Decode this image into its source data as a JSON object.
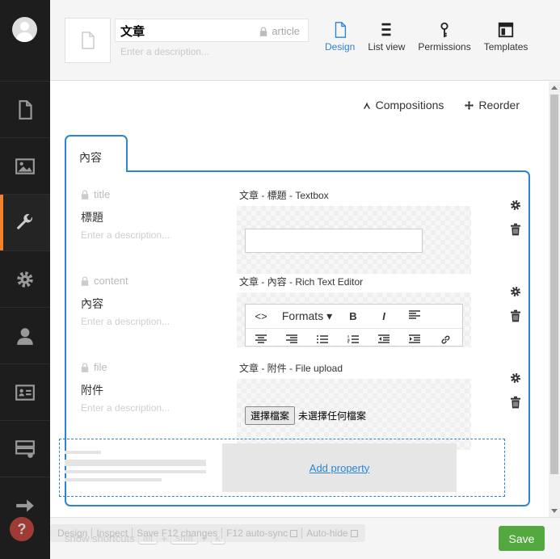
{
  "header": {
    "name_value": "文章",
    "alias": "article",
    "description_placeholder": "Enter a description...",
    "tabs": [
      {
        "label": "Design",
        "icon": "document-icon",
        "active": true
      },
      {
        "label": "List view",
        "icon": "list-icon",
        "active": false
      },
      {
        "label": "Permissions",
        "icon": "key-icon",
        "active": false
      },
      {
        "label": "Templates",
        "icon": "template-icon",
        "active": false
      }
    ]
  },
  "sidebar": {
    "items": [
      {
        "name": "content",
        "icon": "document-icon"
      },
      {
        "name": "media",
        "icon": "image-icon"
      },
      {
        "name": "settings",
        "icon": "wrench-icon",
        "active": true
      },
      {
        "name": "developer",
        "icon": "gear-icon"
      },
      {
        "name": "users",
        "icon": "user-icon"
      },
      {
        "name": "members",
        "icon": "id-card-icon"
      },
      {
        "name": "forms",
        "icon": "form-icon"
      },
      {
        "name": "exit",
        "icon": "arrow-right-icon"
      }
    ]
  },
  "actions": {
    "compositions": "Compositions",
    "reorder": "Reorder"
  },
  "group": {
    "tab_label": "內容"
  },
  "properties": [
    {
      "alias": "title",
      "label": "標題",
      "description": "Enter a description...",
      "editor_title": "文章 - 標題 - Textbox"
    },
    {
      "alias": "content",
      "label": "內容",
      "description": "Enter a description...",
      "editor_title": "文章 - 內容 - Rich Text Editor",
      "rte": {
        "source": "<>",
        "formats": "Formats",
        "bold": "B",
        "italic": "I"
      }
    },
    {
      "alias": "file",
      "label": "附件",
      "description": "Enter a description...",
      "editor_title": "文章 - 附件 - File upload",
      "file_button": "選擇檔案",
      "file_status": "未選擇任何檔案"
    }
  ],
  "add_property": "Add property",
  "footer": {
    "show_shortcuts": "show shortcuts",
    "keys": [
      "alt",
      "+",
      "shift",
      "+",
      "k"
    ],
    "save": "Save"
  },
  "debugbar": {
    "items": [
      "Design",
      "Inspect",
      "Save F12 changes",
      "F12 auto-sync",
      "Auto-hide"
    ]
  },
  "colors": {
    "accent": "#2b85d4",
    "active_nav": "#f5822a",
    "save": "#53a93f",
    "nav_bg": "#1d1d1d"
  }
}
